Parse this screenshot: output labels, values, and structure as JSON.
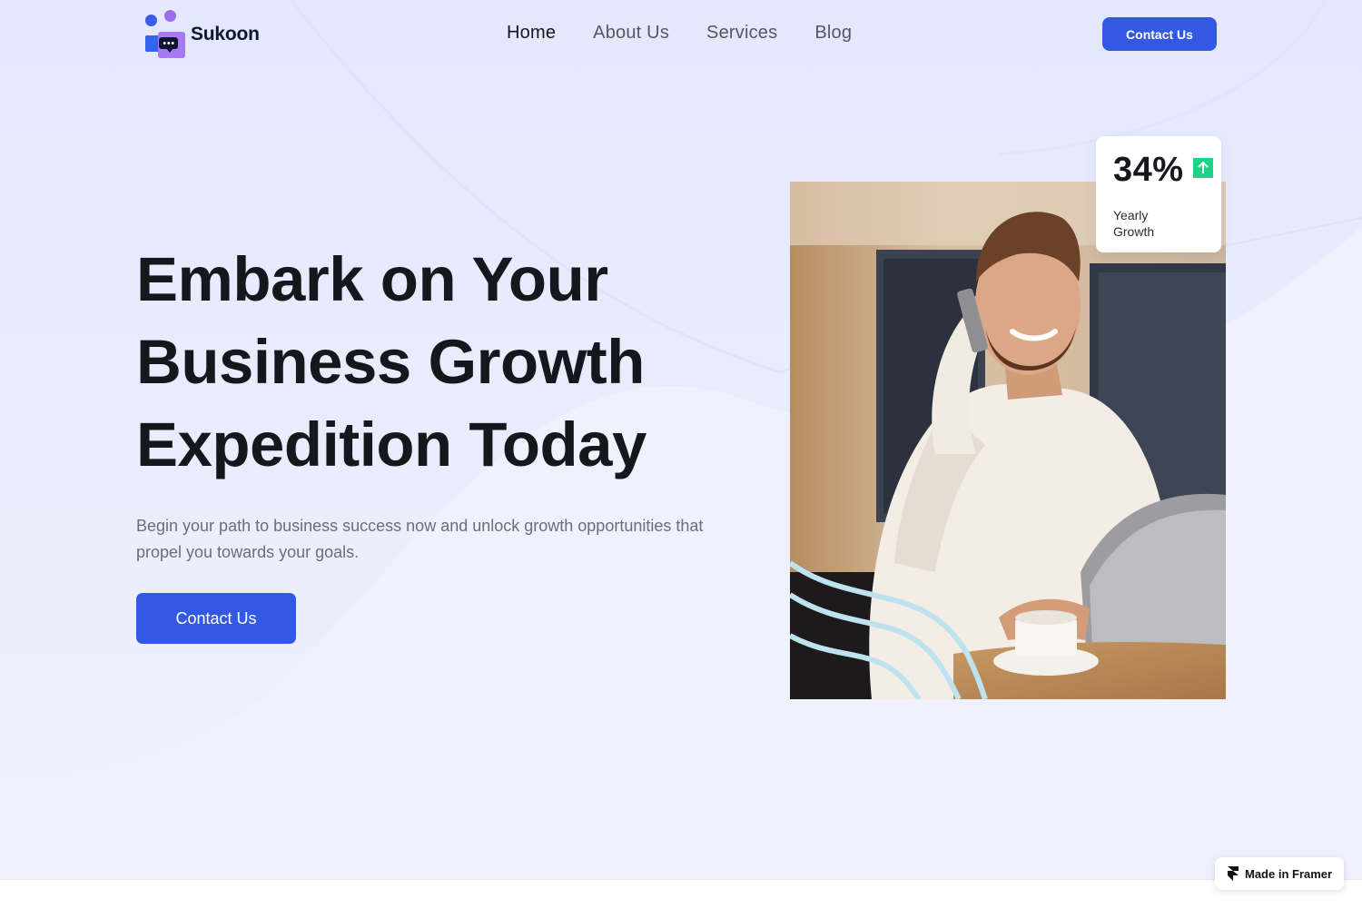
{
  "brand": {
    "name": "Sukoon"
  },
  "nav": {
    "items": [
      {
        "label": "Home",
        "active": true
      },
      {
        "label": "About Us",
        "active": false
      },
      {
        "label": "Services",
        "active": false
      },
      {
        "label": "Blog",
        "active": false
      }
    ],
    "cta_label": "Contact Us"
  },
  "hero": {
    "title_lines": [
      "Embark on Your",
      "Business Growth",
      "Expedition Today"
    ],
    "subtitle": "Begin your path to business success now and unlock growth opportunities that propel you towards your goals.",
    "cta_label": "Contact Us"
  },
  "stat_card": {
    "value": "34%",
    "label": "Yearly Growth",
    "icon": "arrow-up-icon"
  },
  "badge": {
    "label": "Made in Framer",
    "icon": "framer-icon"
  },
  "colors": {
    "accent": "#3358e4",
    "background": "#eff1fd",
    "growth_green": "#1fd286",
    "text_dark": "#16161d",
    "text_muted": "#6b6e78"
  }
}
